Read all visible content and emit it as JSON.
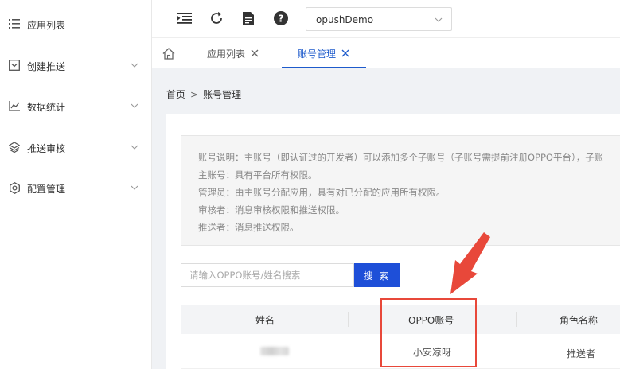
{
  "sidebar": {
    "items": [
      {
        "label": "应用列表",
        "icon": "list-icon",
        "has_submenu": false
      },
      {
        "label": "创建推送",
        "icon": "create-push-icon",
        "has_submenu": true
      },
      {
        "label": "数据统计",
        "icon": "line-chart-icon",
        "has_submenu": true
      },
      {
        "label": "推送审核",
        "icon": "layers-icon",
        "has_submenu": true
      },
      {
        "label": "配置管理",
        "icon": "gear-icon",
        "has_submenu": true
      }
    ]
  },
  "topbar": {
    "icons": [
      "menu-collapse-icon",
      "refresh-icon",
      "document-icon",
      "help-icon"
    ],
    "app_select": {
      "value": "opushDemo"
    }
  },
  "tabs": {
    "home_icon": "home-icon",
    "items": [
      {
        "label": "应用列表",
        "active": false
      },
      {
        "label": "账号管理",
        "active": true
      }
    ]
  },
  "breadcrumb": {
    "home": "首页",
    "separator": ">",
    "current": "账号管理"
  },
  "notice": {
    "lines": [
      "账号说明：主账号（即认证过的开发者）可以添加多个子账号（子账号需提前注册OPPO平台），子账",
      "主账号：具有平台所有权限。",
      "管理员：由主账号分配应用，具有对已分配的应用所有权限。",
      "审核者：消息审核权限和推送权限。",
      "推送者：消息推送权限。"
    ]
  },
  "search": {
    "placeholder": "请输入OPPO账号/姓名搜索",
    "button_label": "搜 索"
  },
  "table": {
    "columns": [
      "姓名",
      "OPPO账号",
      "角色名称"
    ],
    "rows": [
      {
        "account": "小安凉呀",
        "role": "推送者"
      }
    ]
  },
  "annotation": {
    "color": "#e8483a"
  },
  "colors": {
    "accent": "#1e5bcc",
    "button": "#1e4fd8"
  }
}
